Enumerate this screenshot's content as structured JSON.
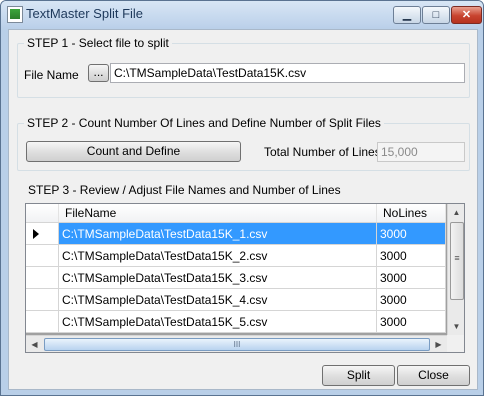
{
  "window": {
    "title": "TextMaster Split File",
    "minimize_glyph": "▁",
    "maximize_glyph": "□",
    "close_glyph": "✕",
    "icon": "app-spreadsheet-icon"
  },
  "step1": {
    "legend": "STEP 1 - Select file to split",
    "file_label": "File Name",
    "browse_label": "...",
    "file_value": "C:\\TMSampleData\\TestData15K.csv"
  },
  "step2": {
    "legend": "STEP 2 - Count Number Of Lines and Define Number of Split Files",
    "count_button": "Count and Define",
    "total_label": "Total Number of Lines",
    "total_value": "15,000"
  },
  "step3": {
    "legend": "STEP 3 - Review / Adjust File Names and Number of Lines",
    "columns": [
      "FileName",
      "NoLines"
    ],
    "rows": [
      {
        "file": "C:\\TMSampleData\\TestData15K_1.csv",
        "lines": "3000",
        "selected": true
      },
      {
        "file": "C:\\TMSampleData\\TestData15K_2.csv",
        "lines": "3000",
        "selected": false
      },
      {
        "file": "C:\\TMSampleData\\TestData15K_3.csv",
        "lines": "3000",
        "selected": false
      },
      {
        "file": "C:\\TMSampleData\\TestData15K_4.csv",
        "lines": "3000",
        "selected": false
      },
      {
        "file": "C:\\TMSampleData\\TestData15K_5.csv",
        "lines": "3000",
        "selected": false
      }
    ],
    "scroll_up": "▲",
    "scroll_down": "▼",
    "scroll_left": "◀",
    "scroll_right": "▶",
    "vgrip": "≡",
    "hgrip": "III"
  },
  "footer": {
    "split_button": "Split",
    "close_button": "Close"
  },
  "colors": {
    "selection": "#3399ff",
    "window_frame": "#b9cfe8",
    "close_button": "#c8432f"
  }
}
